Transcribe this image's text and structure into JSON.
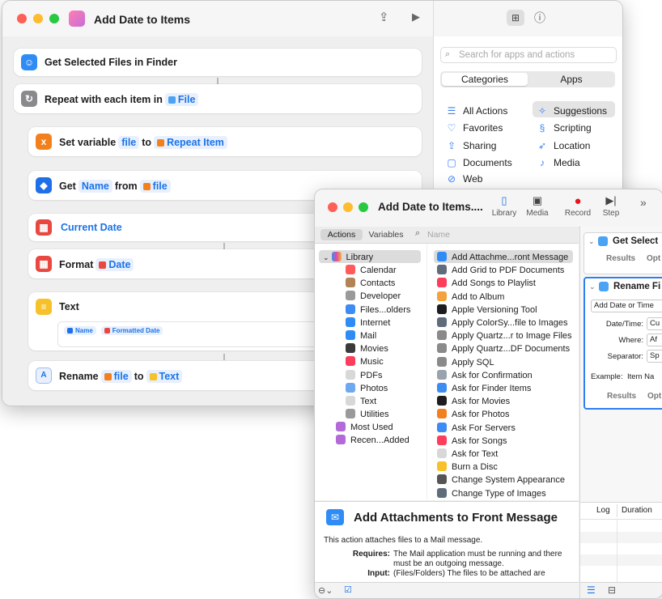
{
  "shortcuts": {
    "title": "Add Date to Items",
    "search_placeholder": "Search for apps and actions",
    "seg": [
      "Categories",
      "Apps"
    ],
    "categories_left": [
      "All Actions",
      "Favorites",
      "Sharing",
      "Documents",
      "Web"
    ],
    "categories_right": [
      "Suggestions",
      "Scripting",
      "Location",
      "Media"
    ],
    "actions": {
      "get_selected": "Get Selected Files in Finder",
      "repeat_label": "Repeat with each item in",
      "repeat_token": "File",
      "setvar_label": "Set variable",
      "setvar_var": "file",
      "setvar_to": "to",
      "setvar_token": "Repeat Item",
      "get_label": "Get",
      "get_prop": "Name",
      "get_from": "from",
      "get_token": "file",
      "current_date": "Current Date",
      "format_label": "Format",
      "format_token": "Date",
      "text_label": "Text",
      "text_tok1": "Name",
      "text_tok2": "Formatted Date",
      "rename_label": "Rename",
      "rename_token": "file",
      "rename_to": "to",
      "rename_token2": "Text"
    }
  },
  "automator": {
    "title": "Add Date to Items....",
    "toolbar": [
      "Library",
      "Media",
      "Record",
      "Step"
    ],
    "tabs": [
      "Actions",
      "Variables"
    ],
    "search_placeholder": "Name",
    "library_root": "Library",
    "library": [
      "Calendar",
      "Contacts",
      "Developer",
      "Files...olders",
      "Internet",
      "Mail",
      "Movies",
      "Music",
      "PDFs",
      "Photos",
      "Text",
      "Utilities"
    ],
    "library_extra": [
      "Most Used",
      "Recen...Added"
    ],
    "actions": [
      "Add Attachme...ront Message",
      "Add Grid to PDF Documents",
      "Add Songs to Playlist",
      "Add to Album",
      "Apple Versioning Tool",
      "Apply ColorSy...file to Images",
      "Apply Quartz...r to Image Files",
      "Apply Quartz...DF Documents",
      "Apply SQL",
      "Ask for Confirmation",
      "Ask for Finder Items",
      "Ask for Movies",
      "Ask for Photos",
      "Ask For Servers",
      "Ask for Songs",
      "Ask for Text",
      "Burn a Disc",
      "Change System Appearance",
      "Change Type of Images"
    ],
    "desc_title": "Add Attachments to Front Message",
    "desc_text": "This action attaches files to a Mail message.",
    "requires_label": "Requires:",
    "requires_text": "The Mail application must be running and there must be an outgoing message.",
    "input_label": "Input:",
    "input_text": "(Files/Folders) The files to be attached are",
    "wf1_title": "Get Select",
    "wf_results": "Results",
    "wf_options": "Opt",
    "wf2_title": "Rename Fi",
    "wf2_select": "Add Date or Time",
    "wf2_fields": [
      "Date/Time:",
      "Where:",
      "Separator:"
    ],
    "wf2_values": [
      "Cu",
      "Af",
      "Sp"
    ],
    "wf2_example_label": "Example:",
    "wf2_example": "Item Na",
    "log_cols": [
      "Log",
      "Duration"
    ]
  },
  "colors": {
    "accent": "#1a73e8",
    "red": "#fe5f57",
    "yellow": "#febc2e",
    "green": "#28c840"
  }
}
